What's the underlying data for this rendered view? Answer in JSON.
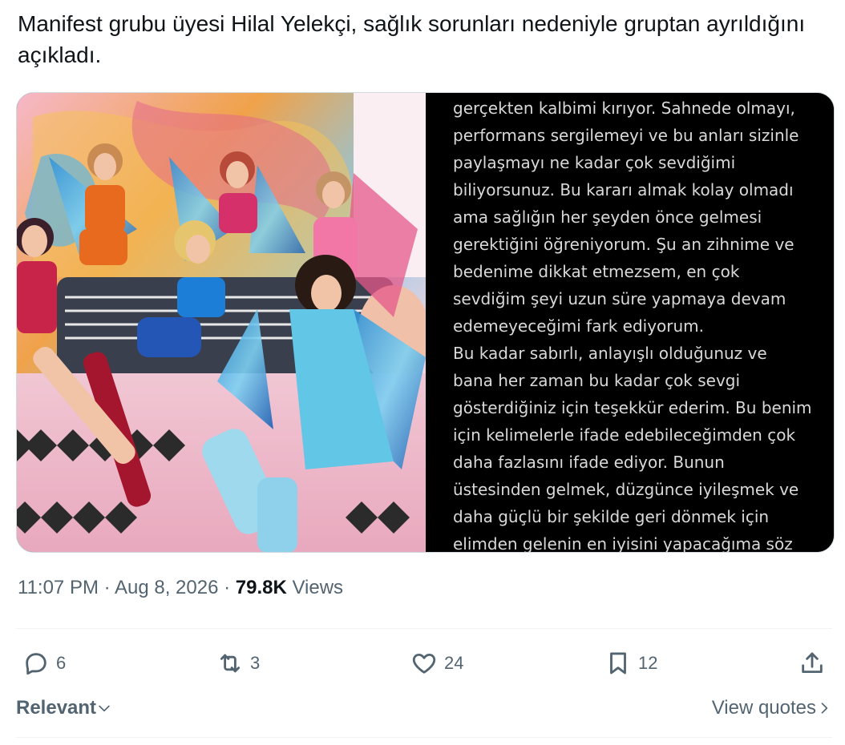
{
  "tweet": {
    "text": "Manifest grubu üyesi Hilal Yelekçi, sağlık sorunları nedeniyle gruptan ayrıldığını açıkladı."
  },
  "media": {
    "photo_alt_icon": "group-photo",
    "statement_lines": [
      "gerçekten kalbimi kırıyor. Sahnede olmayı,",
      "performans sergilemeyi ve bu anları sizinle",
      "paylaşmayı ne kadar çok sevdiğimi",
      "biliyorsunuz. Bu kararı almak kolay olmadı",
      "ama sağlığın her şeyden önce gelmesi",
      "gerektiğini öğreniyorum. Şu an zihnime ve",
      "bedenime dikkat etmezsem, en çok",
      "sevdiğim şeyi uzun süre yapmaya devam",
      "edemeyeceğimi fark ediyorum.",
      "Bu kadar sabırlı, anlayışlı olduğunuz ve",
      "bana her zaman bu kadar çok sevgi",
      "gösterdiğiniz için teşekkür ederim. Bu benim",
      "için kelimelerle ifade edebileceğimden çok",
      "daha fazlasını ifade ediyor. Bunun",
      "üstesinden gelmek, düzgünce iyileşmek ve",
      "daha güçlü bir şekilde geri dönmek için",
      "elimden gelenin en iyisini yapacağıma söz"
    ]
  },
  "meta": {
    "time": "11:07 PM",
    "sep1": " · ",
    "date": "Aug 8, 2026",
    "sep2": " · ",
    "views_count": "79.8K",
    "views_label": " Views"
  },
  "actions": {
    "replies": "6",
    "reposts": "3",
    "likes": "24",
    "bookmarks": "12"
  },
  "footer": {
    "sort_label": "Relevant",
    "view_quotes_label": "View quotes"
  },
  "colors": {
    "text_primary": "#0f1419",
    "text_secondary": "#536471",
    "border": "#cfd9de"
  }
}
